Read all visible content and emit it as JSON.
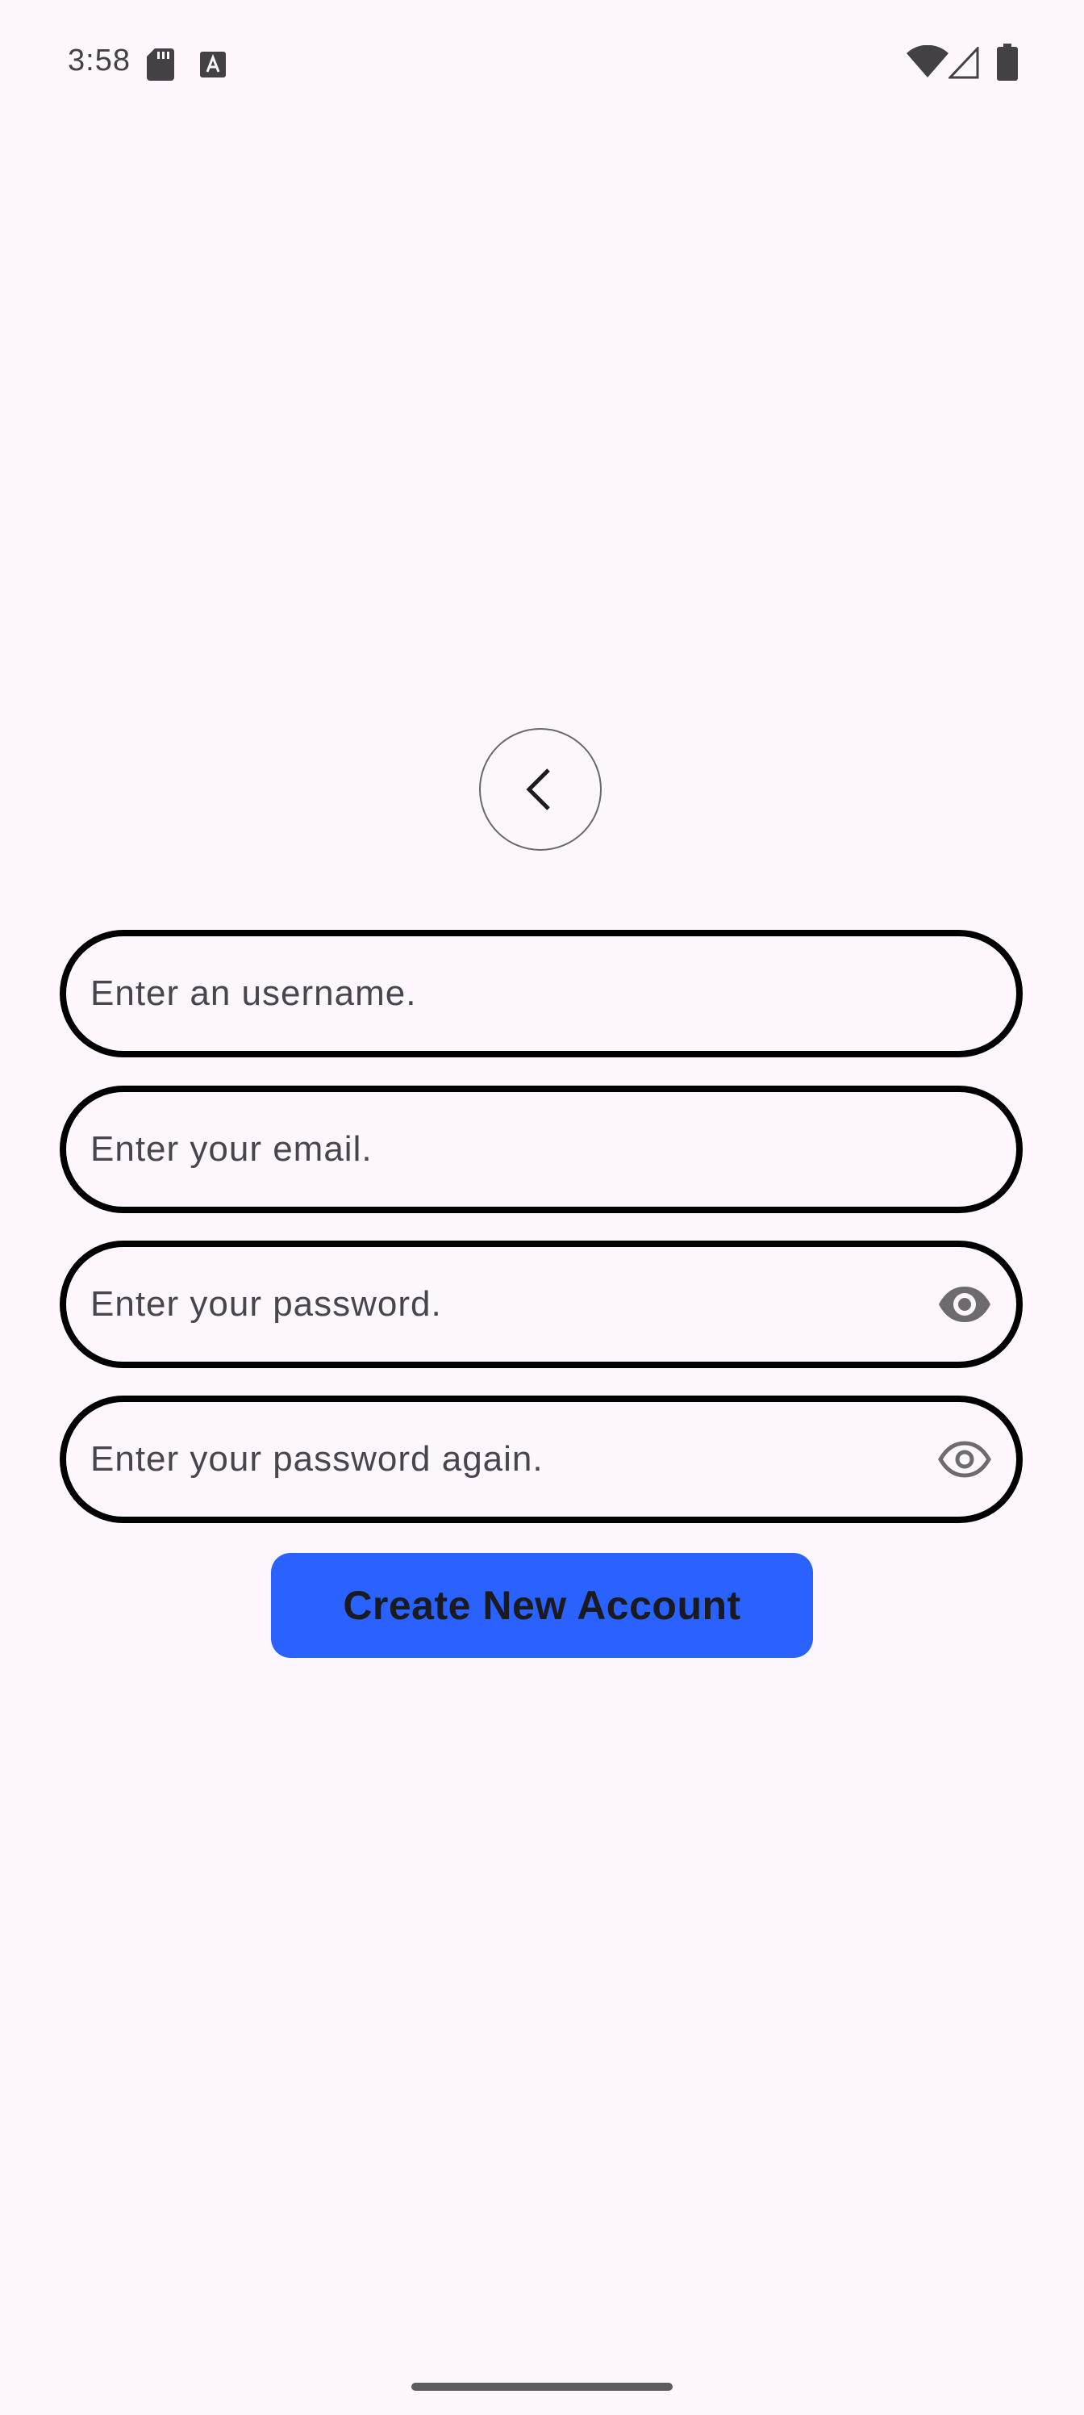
{
  "status_bar": {
    "time": "3:58",
    "icons": [
      "sd-card-icon",
      "text-a-icon",
      "wifi-icon",
      "cell-signal-icon",
      "battery-icon"
    ]
  },
  "navigation": {
    "back_icon": "chevron-left-icon"
  },
  "form": {
    "username": {
      "value": "",
      "placeholder": "Enter an username."
    },
    "email": {
      "value": "",
      "placeholder": "Enter your email."
    },
    "password": {
      "value": "",
      "placeholder": "Enter your password.",
      "toggle_icon": "eye-icon"
    },
    "password_confirm": {
      "value": "",
      "placeholder": "Enter your password again.",
      "toggle_icon": "eye-icon"
    },
    "submit_label": "Create New Account"
  },
  "colors": {
    "background": "#fdf7fd",
    "accent": "#2962ff",
    "field_border": "#000000",
    "placeholder": "#49454f"
  }
}
